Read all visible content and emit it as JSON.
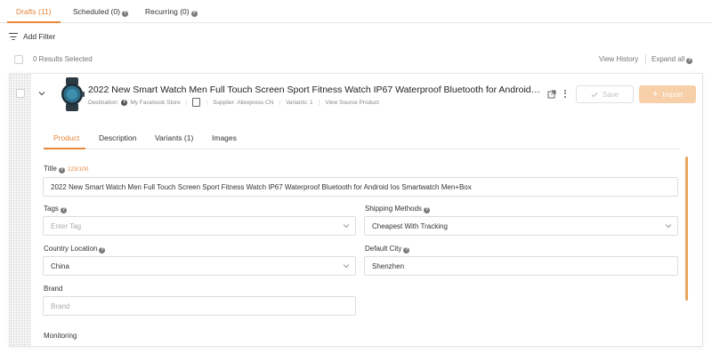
{
  "tabs": [
    {
      "label": "Drafts (11)",
      "active": true
    },
    {
      "label": "Scheduled (0)",
      "active": false
    },
    {
      "label": "Recurring (0)",
      "active": false
    }
  ],
  "filter": {
    "label": "Add Filter",
    "icon": "filter-icon"
  },
  "results": {
    "label": "0 Results Selected",
    "view_history": "View History",
    "expand_all": "Expand all"
  },
  "product": {
    "title": "2022 New Smart Watch Men Full Touch Screen Sport Fitness Watch IP67 Waterproof Bluetooth for Android Ios Smartwatch Men+Box",
    "destination_label": "Destination:",
    "store": "My Facebook Store",
    "supplier": "Supplier: Aliexpress CN",
    "variants": "Variants: 1",
    "view_source": "View Source Product",
    "save_label": "Save",
    "import_label": "Import"
  },
  "inner_tabs": [
    {
      "label": "Product",
      "active": true
    },
    {
      "label": "Description",
      "active": false
    },
    {
      "label": "Variants (1)",
      "active": false
    },
    {
      "label": "Images",
      "active": false
    }
  ],
  "form": {
    "title_label": "Title",
    "title_counter": "123/100",
    "title_value": "2022 New Smart Watch Men Full Touch Screen Sport Fitness Watch IP67 Waterproof Bluetooth for Android Ios Smartwatch Men+Box",
    "tags_label": "Tags",
    "tags_placeholder": "Enter Tag",
    "shipping_label": "Shipping Methods",
    "shipping_value": "Cheapest With Tracking",
    "country_label": "Country Location",
    "country_value": "China",
    "city_label": "Default City",
    "city_value": "Shenzhen",
    "brand_label": "Brand",
    "brand_placeholder": "Brand",
    "monitoring_label": "Monitoring"
  },
  "colors": {
    "accent": "#e8873a",
    "import_disabled": "#f7cfa9"
  }
}
